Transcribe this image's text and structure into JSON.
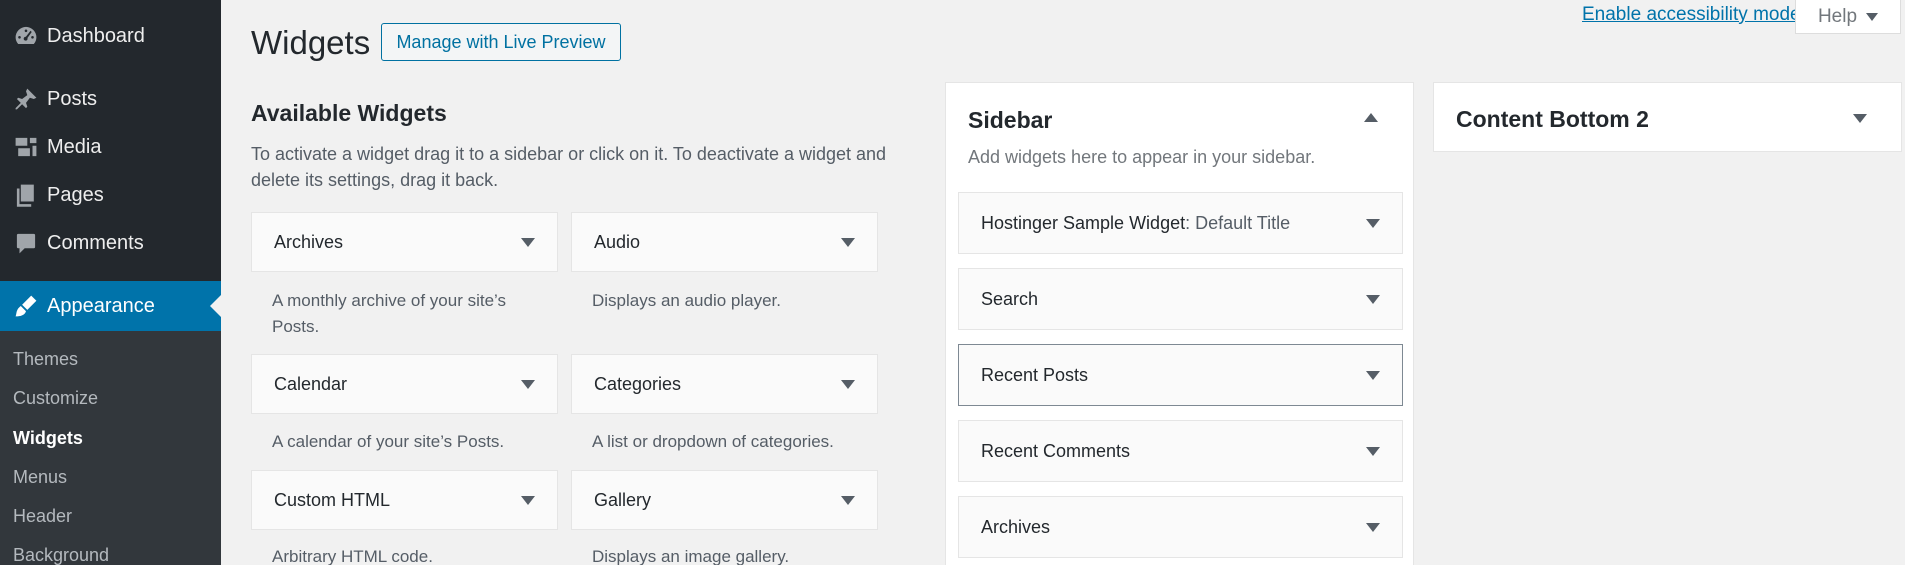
{
  "menu": {
    "items": [
      {
        "label": "Dashboard",
        "icon": "dashboard-icon"
      },
      {
        "label": "Posts",
        "icon": "pin-icon"
      },
      {
        "label": "Media",
        "icon": "media-icon"
      },
      {
        "label": "Pages",
        "icon": "pages-icon"
      },
      {
        "label": "Comments",
        "icon": "comments-icon"
      },
      {
        "label": "Appearance",
        "icon": "brush-icon"
      }
    ],
    "submenu": [
      "Themes",
      "Customize",
      "Widgets",
      "Menus",
      "Header",
      "Background"
    ],
    "current_submenu": "Widgets"
  },
  "screen_meta": {
    "accessibility_link": "Enable accessibility mode",
    "help_label": "Help"
  },
  "header": {
    "title": "Widgets",
    "live_preview_button": "Manage with Live Preview"
  },
  "available_widgets": {
    "heading": "Available Widgets",
    "description": "To activate a widget drag it to a sidebar or click on it. To deactivate a widget and delete its settings, drag it back.",
    "widgets": [
      {
        "title": "Archives",
        "description": "A monthly archive of your site’s Posts."
      },
      {
        "title": "Audio",
        "description": "Displays an audio player."
      },
      {
        "title": "Calendar",
        "description": "A calendar of your site’s Posts."
      },
      {
        "title": "Categories",
        "description": "A list or dropdown of categories."
      },
      {
        "title": "Custom HTML",
        "description": "Arbitrary HTML code."
      },
      {
        "title": "Gallery",
        "description": "Displays an image gallery."
      }
    ]
  },
  "sidebar_area": {
    "title": "Sidebar",
    "description": "Add widgets here to appear in your sidebar.",
    "widgets": [
      {
        "title": "Hostinger Sample Widget",
        "subtitle": ": Default Title"
      },
      {
        "title": "Search",
        "subtitle": ""
      },
      {
        "title": "Recent Posts",
        "subtitle": ""
      },
      {
        "title": "Recent Comments",
        "subtitle": ""
      },
      {
        "title": "Archives",
        "subtitle": ""
      }
    ]
  },
  "content_bottom_area": {
    "title": "Content Bottom 2"
  },
  "colors": {
    "admin_menu_bg": "#23282d",
    "submenu_bg": "#32373c",
    "accent": "#0073aa",
    "page_bg": "#f1f1f1"
  }
}
